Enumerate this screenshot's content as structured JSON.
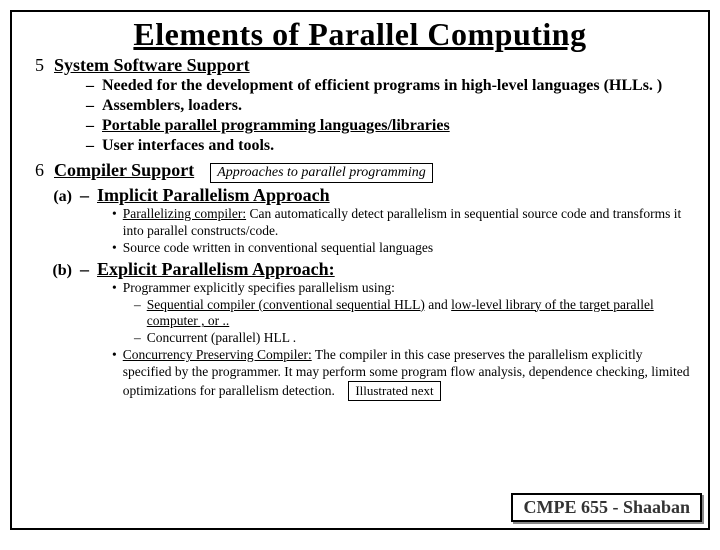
{
  "title": "Elements of Parallel Computing",
  "section5": {
    "num": "5",
    "heading": "System Software Support",
    "items": [
      {
        "text": "Needed for the development of efficient programs in high-level languages (HLLs. )"
      },
      {
        "text": "Assemblers, loaders."
      },
      {
        "text_u": "Portable parallel programming languages/libraries"
      },
      {
        "text": "User interfaces and tools."
      }
    ]
  },
  "section6": {
    "num": "6",
    "heading": "Compiler Support",
    "note": "Approaches to parallel programming",
    "a": {
      "label": "(a)",
      "heading": "Implicit Parallelism Approach",
      "b1_lead": "Parallelizing compiler:",
      "b1_rest": "  Can automatically detect parallelism in sequential source code and transforms it into parallel constructs/code.",
      "b2": "Source code written in conventional sequential languages"
    },
    "b": {
      "label": "(b)",
      "heading": "Explicit Parallelism Approach:",
      "b1": "Programmer explicitly specifies parallelism using:",
      "b1s1_lead": "Sequential compiler (conventional sequential HLL)",
      "b1s1_mid": "  and ",
      "b1s1_tail": "low-level library of the target parallel computer , or ..",
      "b1s2": "Concurrent (parallel) HLL .",
      "b2_lead": "Concurrency Preserving Compiler:",
      "b2_rest": " The compiler in this case preserves the parallelism explicitly specified by the programmer.  It may perform some program flow analysis, dependence checking, limited optimizations for parallelism detection.",
      "illus": "Illustrated next"
    }
  },
  "footer": "CMPE 655 - Shaaban"
}
